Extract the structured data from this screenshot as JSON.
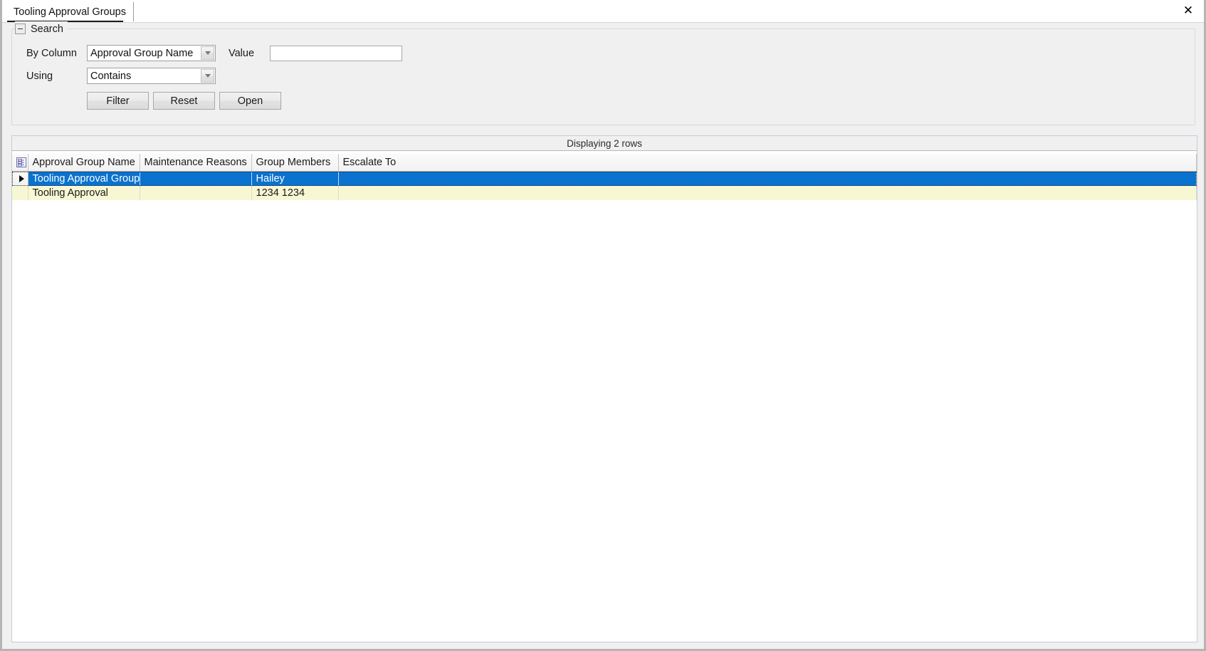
{
  "window": {
    "close_label": "✕"
  },
  "tab": {
    "label": "Tooling Approval Groups"
  },
  "search_panel": {
    "title": "Search",
    "collapse_icon": "minus-icon",
    "by_column_label": "By Column",
    "by_column_value": "Approval Group Name",
    "value_label": "Value",
    "value_input": "",
    "value_placeholder": "",
    "using_label": "Using",
    "using_value": "Contains",
    "buttons": {
      "filter": "Filter",
      "reset": "Reset",
      "open": "Open"
    }
  },
  "grid": {
    "caption": "Displaying 2 rows",
    "corner_icon": "grid-select-all-icon",
    "columns": [
      "Approval Group Name",
      "Maintenance Reasons",
      "Group Members",
      "Escalate To"
    ],
    "rows": [
      {
        "selected": true,
        "marker": "row-current-arrow-icon",
        "cells": [
          "Tooling Approval Group",
          "",
          "Hailey",
          ""
        ]
      },
      {
        "selected": false,
        "marker": "",
        "cells": [
          "Tooling Approval",
          "",
          "1234 1234",
          ""
        ]
      }
    ]
  },
  "colors": {
    "selection": "#0a72cf",
    "alt_row": "#f8f7d4",
    "chrome": "#f0f0f0"
  }
}
